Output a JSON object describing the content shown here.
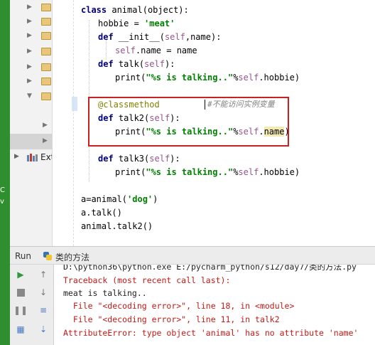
{
  "left_strip": {
    "fragments": [
      "C",
      "v"
    ]
  },
  "project_tree": {
    "ext_label": "Ext"
  },
  "editor": {
    "lines": {
      "l1_class": "class ",
      "l1_name": "animal",
      "l1_args": "(object):",
      "l2_var": "hobbie = ",
      "l2_val": "'meat'",
      "l3_def": "def ",
      "l3_fn": "__init__",
      "l3_args_a": "(",
      "l3_self": "self",
      "l3_args_b": ",name):",
      "l4_self": "self",
      "l4_rest": ".name = name",
      "l5_def": "def ",
      "l5_fn": "talk",
      "l5_a": "(",
      "l5_self": "self",
      "l5_b": "):",
      "l6_print": "print(",
      "l6_str": "\"%s is talking..\"",
      "l6_pct": "%",
      "l6_self": "self",
      "l6_rest": ".hobbie)",
      "l7_deco": "@classmethod",
      "l7_comment": "#不能访问实例变量",
      "l8_def": "def ",
      "l8_fn": "talk2",
      "l8_a": "(",
      "l8_self": "self",
      "l8_b": "):",
      "l9_print": "print(",
      "l9_str": "\"%s is talking..\"",
      "l9_pct": "%",
      "l9_self": "self",
      "l9_dot": ".",
      "l9_name": "name",
      "l9_close": ")",
      "l10_def": "def ",
      "l10_fn": "talk3",
      "l10_a": "(",
      "l10_self": "self",
      "l10_b": "):",
      "l11_print": "print(",
      "l11_str": "\"%s is talking..\"",
      "l11_pct": "%",
      "l11_self": "self",
      "l11_rest": ".hobbie)",
      "l12_a": "a=animal(",
      "l12_str": "'dog'",
      "l12_b": ")",
      "l13": "a.talk()",
      "l14": "animal.talk2()"
    }
  },
  "run_panel": {
    "label": "Run",
    "tab_title": "类的方法"
  },
  "console": {
    "lines": [
      {
        "text": "D:\\python36\\python.exe E:/pycharm_python/s12/day7/类的方法.py",
        "style": "plain"
      },
      {
        "text": "Traceback (most recent call last):",
        "style": "err"
      },
      {
        "text": "meat is talking..",
        "style": "plain"
      },
      {
        "text": "  File \"<decoding error>\", line 18, in <module>",
        "style": "err"
      },
      {
        "text": "  File \"<decoding error>\", line 11, in talk2",
        "style": "err"
      },
      {
        "text": "AttributeError: type object 'animal' has no attribute 'name'",
        "style": "err"
      }
    ]
  },
  "colors": {
    "keyword": "#000080",
    "string": "#008000",
    "self": "#94558d",
    "decorator": "#808000",
    "error": "#c41a16",
    "highlight_box": "#cc1f1f"
  },
  "icons": [
    "folder-icon",
    "library-icon",
    "python-icon",
    "run-icon",
    "stop-icon",
    "pause-icon",
    "arrow-up-icon",
    "arrow-down-icon",
    "wrap-icon",
    "scroll-end-icon"
  ]
}
